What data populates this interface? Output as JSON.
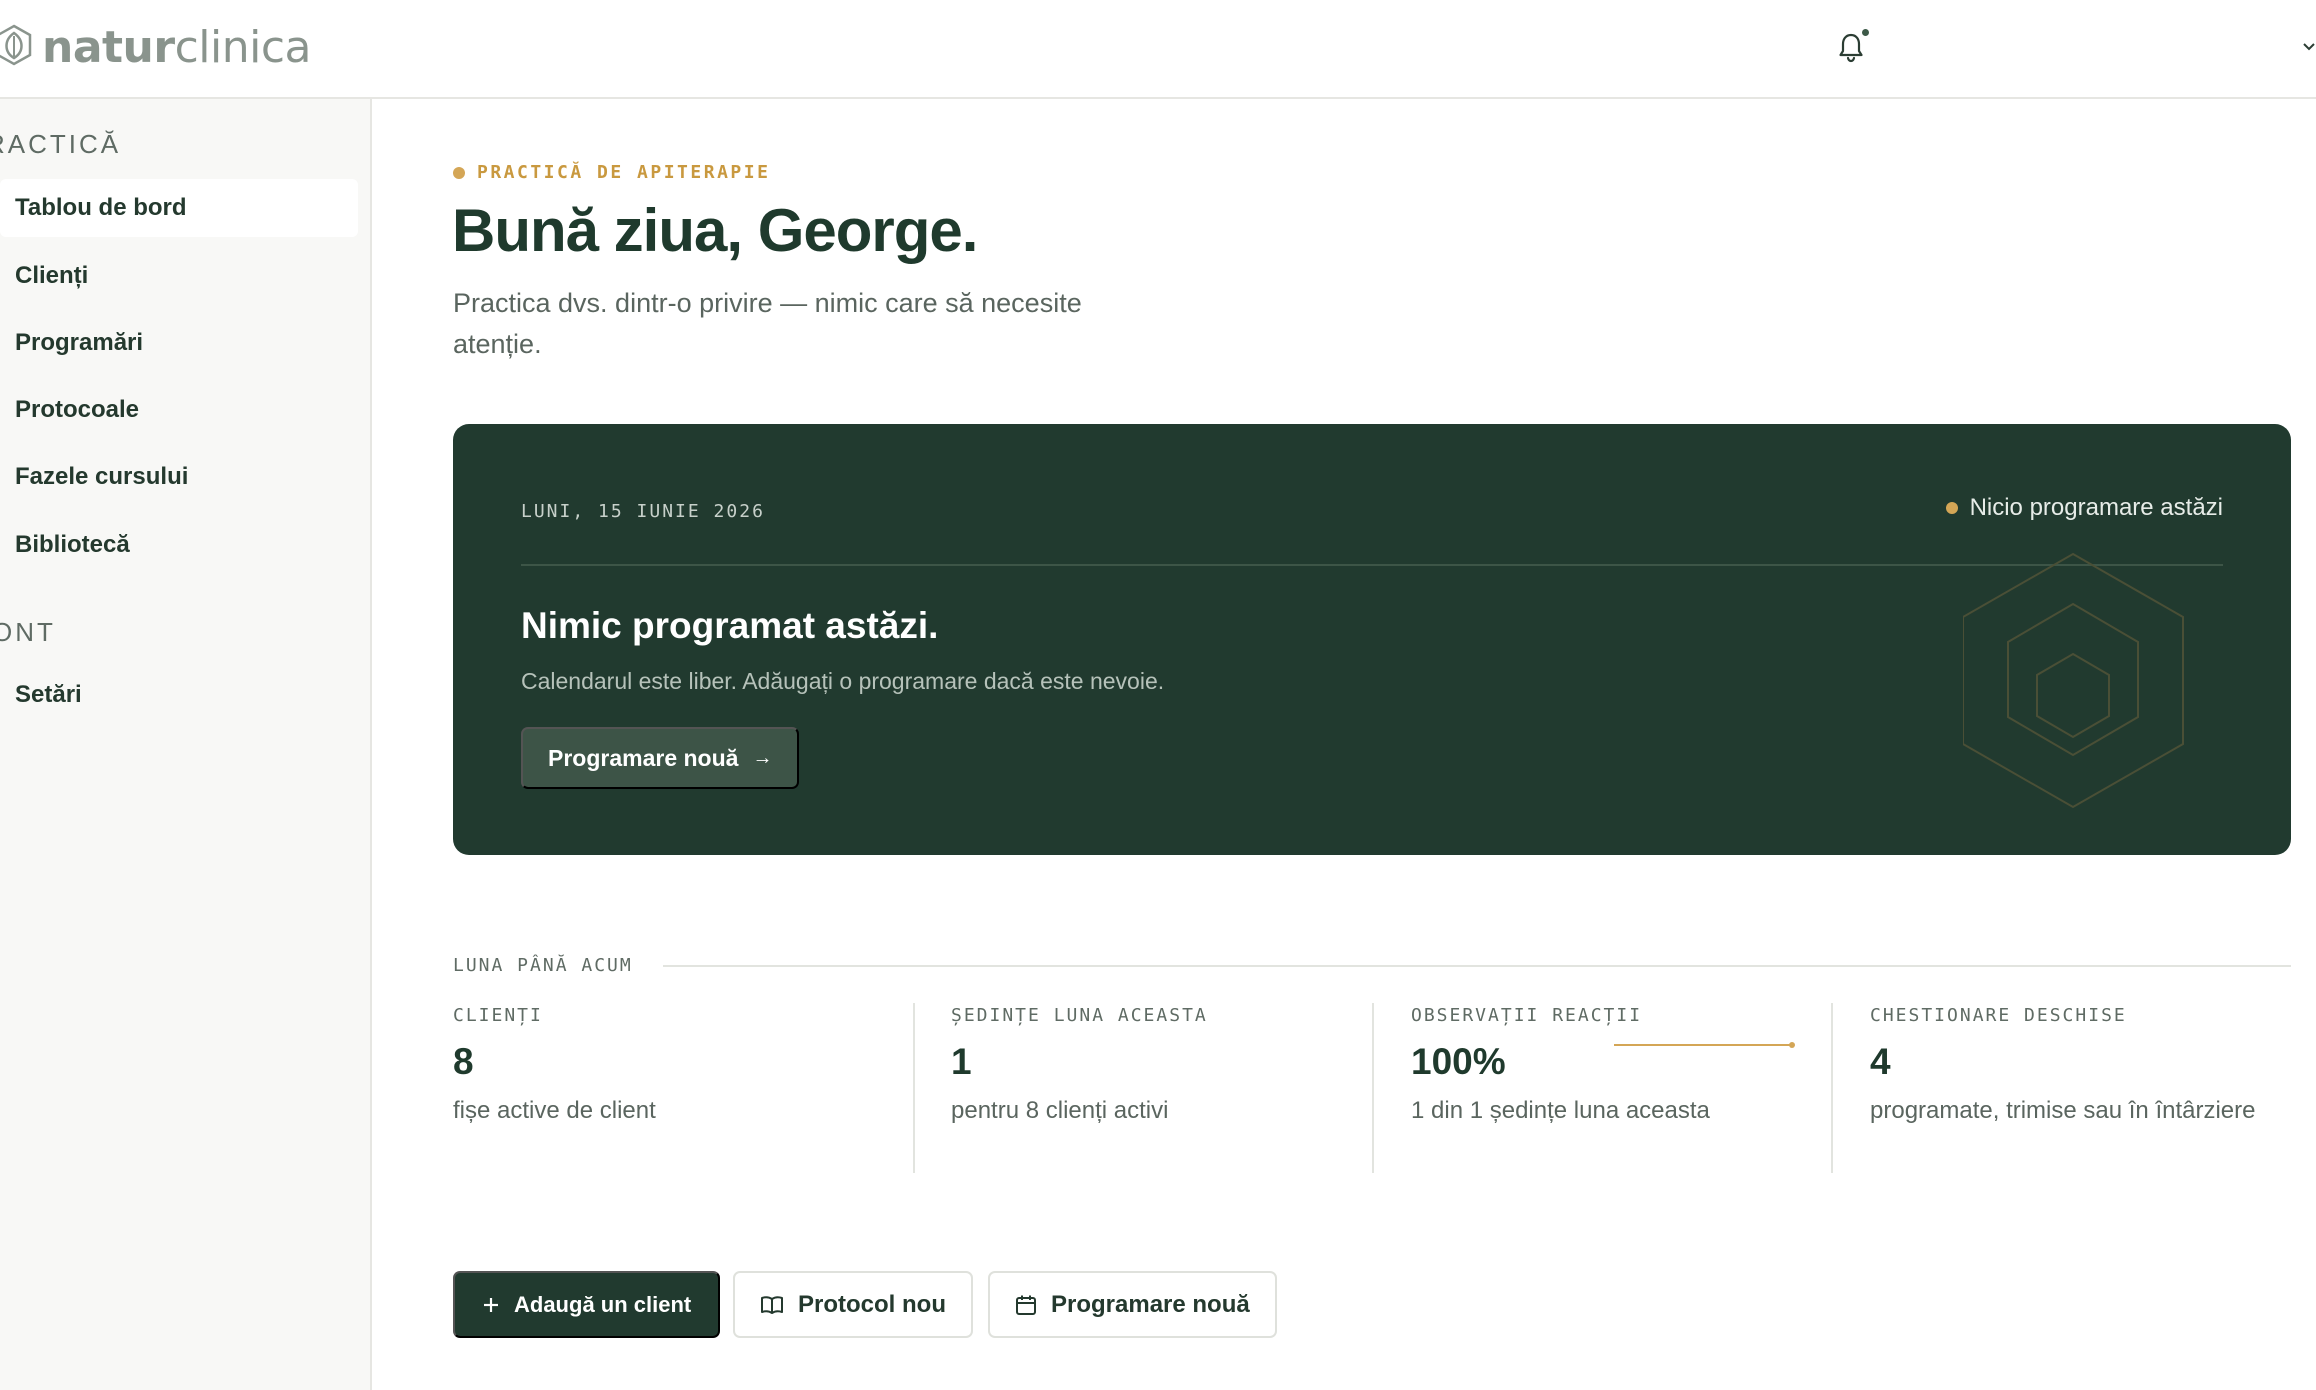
{
  "brand": {
    "name_bold": "natur",
    "name_light": "clinica",
    "icon": "hexagon-leaf-logo"
  },
  "header": {
    "notification_icon": "bell-icon",
    "menu_icon": "chevron-down-icon"
  },
  "sidebar": {
    "sections": [
      {
        "heading": "RACTICĂ"
      },
      {
        "heading": "ONT"
      }
    ],
    "items": [
      {
        "label": "Tablou de bord",
        "active": true
      },
      {
        "label": "Clienți"
      },
      {
        "label": "Programări"
      },
      {
        "label": "Protocoale"
      },
      {
        "label": "Fazele cursului"
      },
      {
        "label": "Bibliotecă"
      },
      {
        "label": "Setări"
      }
    ]
  },
  "main": {
    "eyebrow": "PRACTICĂ DE APITERAPIE",
    "greeting": "Bună ziua, George.",
    "subtitle": "Practica dvs. dintr-o privire — nimic care să necesite atenție.",
    "hero": {
      "date": "LUNI, 15 IUNIE 2026",
      "status": "Nicio programare astăzi",
      "title": "Nimic programat astăzi.",
      "description": "Calendarul este liber. Adăugați o programare dacă este nevoie.",
      "button": "Programare nouă",
      "button_icon": "arrow-right-icon"
    },
    "stats_heading": "LUNA PÂNĂ ACUM",
    "stats": [
      {
        "label": "CLIENȚI",
        "value": "8",
        "note": "fișe active de client"
      },
      {
        "label": "ȘEDINȚE LUNA ACEASTA",
        "value": "1",
        "note": "pentru 8 clienți activi"
      },
      {
        "label": "OBSERVAȚII REACȚII",
        "value": "100%",
        "note": "1 din 1 ședințe luna aceasta",
        "progress": 1.0
      },
      {
        "label": "CHESTIONARE DESCHISE",
        "value": "4",
        "note": "programate, trimise sau în întârziere"
      }
    ],
    "actions": [
      {
        "label": "Adaugă un client",
        "icon": "plus-icon"
      },
      {
        "label": "Protocol nou",
        "icon": "book-icon"
      },
      {
        "label": "Programare nouă",
        "icon": "calendar-icon"
      }
    ]
  },
  "colors": {
    "primary": "#213a2f",
    "accent": "#d4a656",
    "sidebar_bg": "#f8f8f6"
  }
}
